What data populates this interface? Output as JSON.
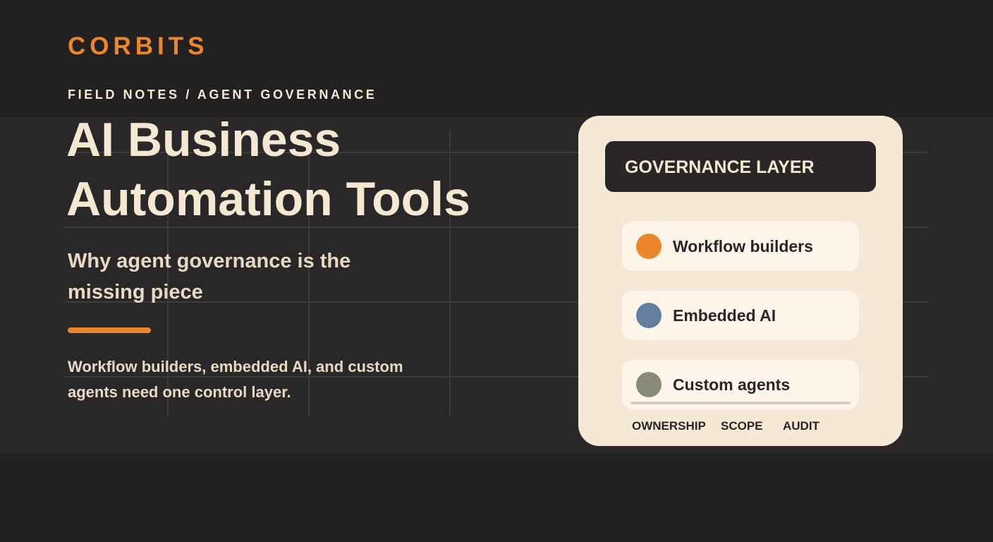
{
  "brand": "CORBITS",
  "eyebrow": "FIELD NOTES / AGENT GOVERNANCE",
  "title": "AI Business Automation Tools",
  "subtitle": "Why agent governance is the missing piece",
  "body": "Workflow builders, embedded AI, and custom agents need one control layer.",
  "card": {
    "header": "GOVERNANCE LAYER",
    "items": [
      {
        "label": "Workflow builders",
        "color": "#ea872a"
      },
      {
        "label": "Embedded AI",
        "color": "#62809e"
      },
      {
        "label": "Custom agents",
        "color": "#8a8b77"
      }
    ],
    "footer": [
      "OWNERSHIP",
      "SCOPE",
      "AUDIT"
    ]
  },
  "colors": {
    "background": "#232021",
    "accent": "#ea872a",
    "text": "#f5e8d2",
    "card": "#f5e9d6"
  }
}
